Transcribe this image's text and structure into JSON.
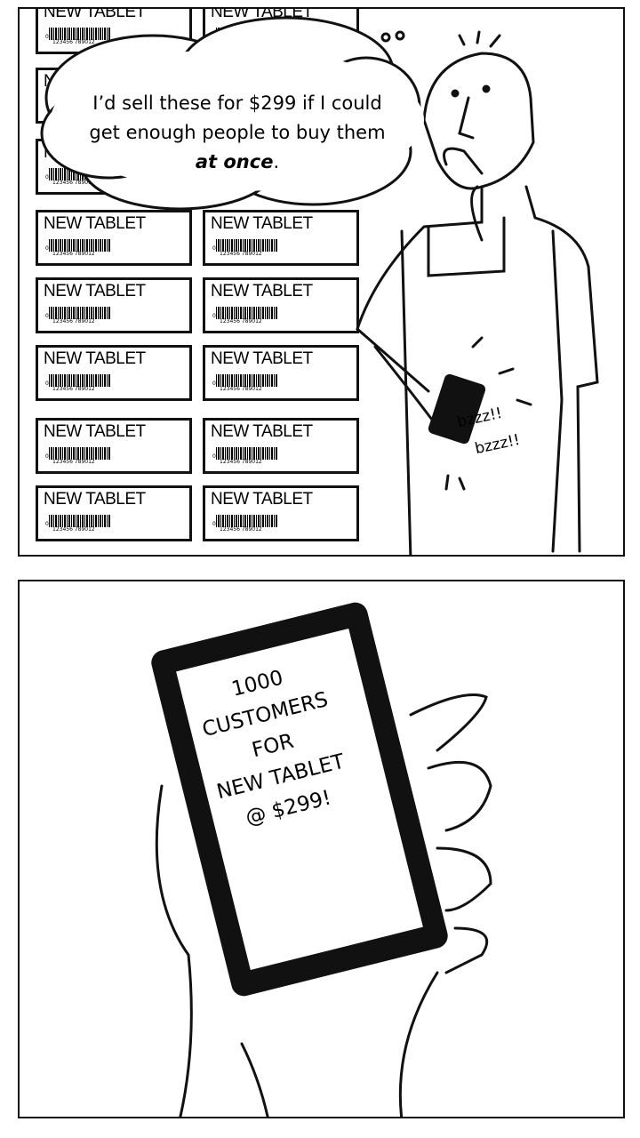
{
  "panel1": {
    "tag_label": "NEW TABLET",
    "barcode_first": "0",
    "barcode_number": "123456 789012",
    "bubble": {
      "line1": "I’d sell these for $299 if I could",
      "line2": "get enough people to buy them",
      "line3_emphasis": "at once",
      "line3_end": "."
    },
    "sound1": "bzzz!!",
    "sound2": "bzzz!!"
  },
  "panel2": {
    "screen_lines": [
      "1000",
      "CUSTOMERS",
      "FOR",
      "NEW TABLET",
      "@ $299!"
    ]
  }
}
